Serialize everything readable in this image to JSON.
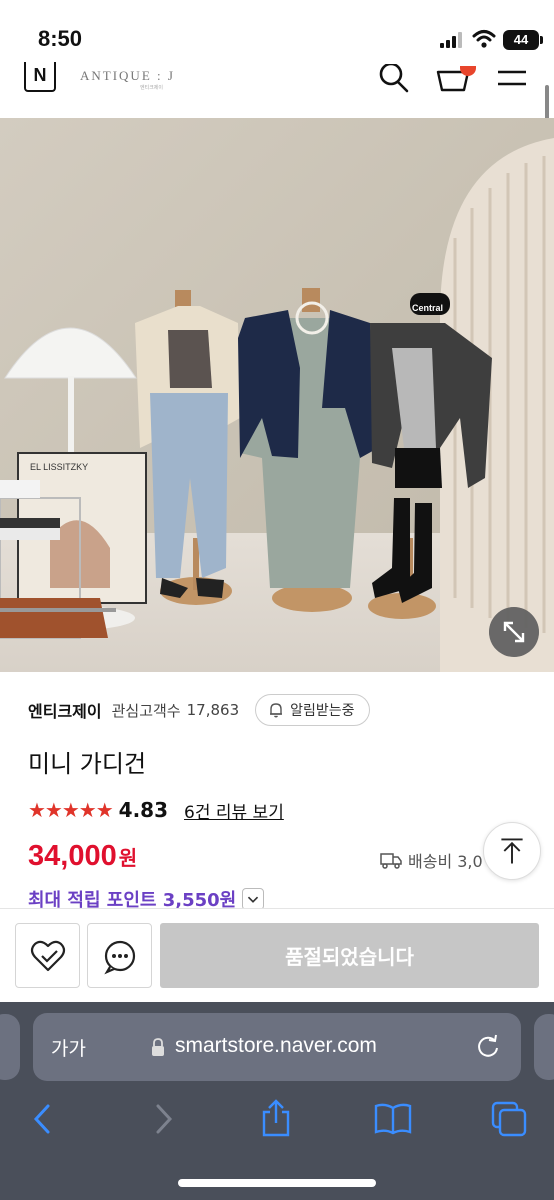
{
  "status_bar": {
    "time": "8:50",
    "battery": "44"
  },
  "store_header": {
    "logo_letter": "N",
    "brand": "ANTIQUE : J",
    "brand_sub": "엔티크제이"
  },
  "seller": {
    "name": "엔티크제이",
    "follower_label": "관심고객수",
    "follower_count": "17,863",
    "alert_label": "알림받는중"
  },
  "product": {
    "title": "미니 가디건",
    "stars": "★★★★★",
    "rating": "4.83",
    "review_link": "6건 리뷰 보기",
    "price": "34,000",
    "price_unit": "원",
    "shipping_label": "배송비 3,0",
    "points_label": "최대 적립 포인트 3,550원"
  },
  "image_text": {
    "cap_text": "Central",
    "poster_text": "EL LISSITZKY"
  },
  "action_bar": {
    "soldout_label": "품절되었습니다"
  },
  "safari": {
    "aa_label": "가가",
    "url": "smartstore.naver.com"
  },
  "colors": {
    "price_red": "#e0102e",
    "points_purple": "#6b40c4",
    "star_red": "#e0342a",
    "safari_bg": "#4a4f5a"
  }
}
